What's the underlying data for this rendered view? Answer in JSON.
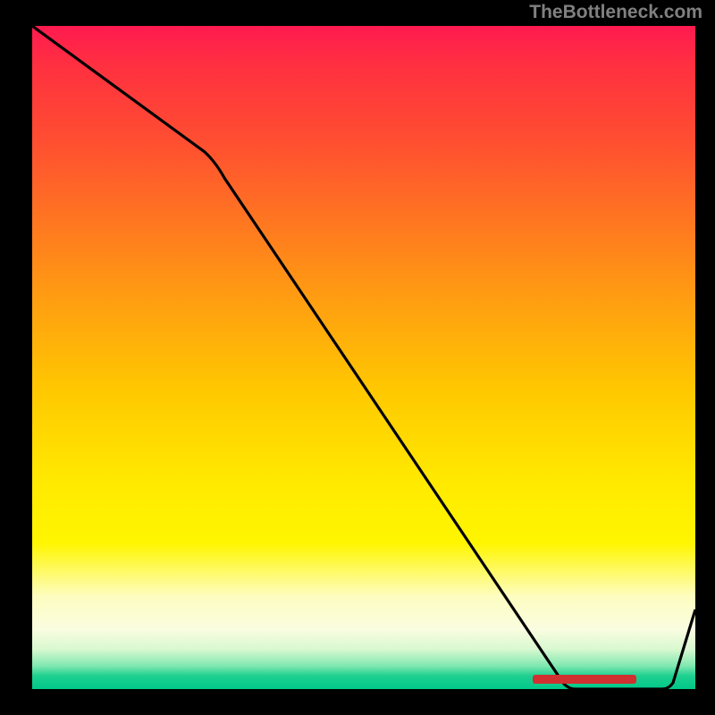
{
  "watermark": "TheBottleneck.com",
  "chart_data": {
    "type": "line",
    "x": [
      0,
      0.26,
      0.8,
      0.95,
      1.0
    ],
    "values": [
      1.0,
      0.81,
      0.01,
      0.0,
      0.12
    ],
    "title": "",
    "xlabel": "",
    "ylabel": "",
    "xlim": [
      0,
      1
    ],
    "ylim": [
      0,
      1
    ],
    "marker": {
      "x_start": 0.76,
      "x_end": 0.91,
      "y": 0.015
    }
  },
  "colors": {
    "background": "#000000",
    "line": "#000000",
    "gradient_top": "#ff1a50",
    "gradient_bottom": "#00c888",
    "marker": "#d03030",
    "watermark": "#808080"
  }
}
